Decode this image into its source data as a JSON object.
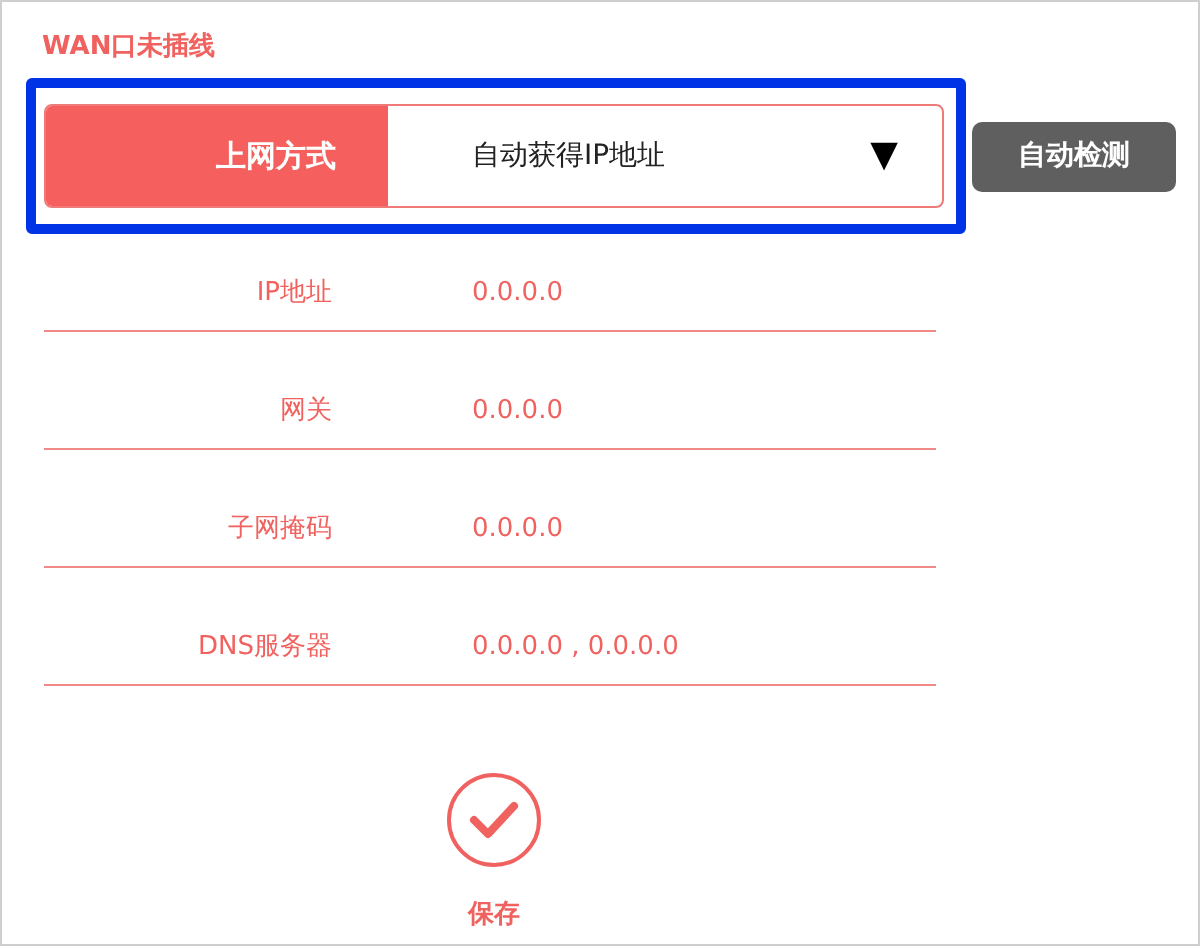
{
  "title": "WAN口未插线",
  "connection_type": {
    "label": "上网方式",
    "value": "自动获得IP地址",
    "dropdown_icon": "▼"
  },
  "detect_button": "自动检测",
  "fields": [
    {
      "label": "IP地址",
      "value": "0.0.0.0"
    },
    {
      "label": "网关",
      "value": "0.0.0.0"
    },
    {
      "label": "子网掩码",
      "value": "0.0.0.0"
    },
    {
      "label": "DNS服务器",
      "value": "0.0.0.0 , 0.0.0.0"
    }
  ],
  "save_button": "保存"
}
